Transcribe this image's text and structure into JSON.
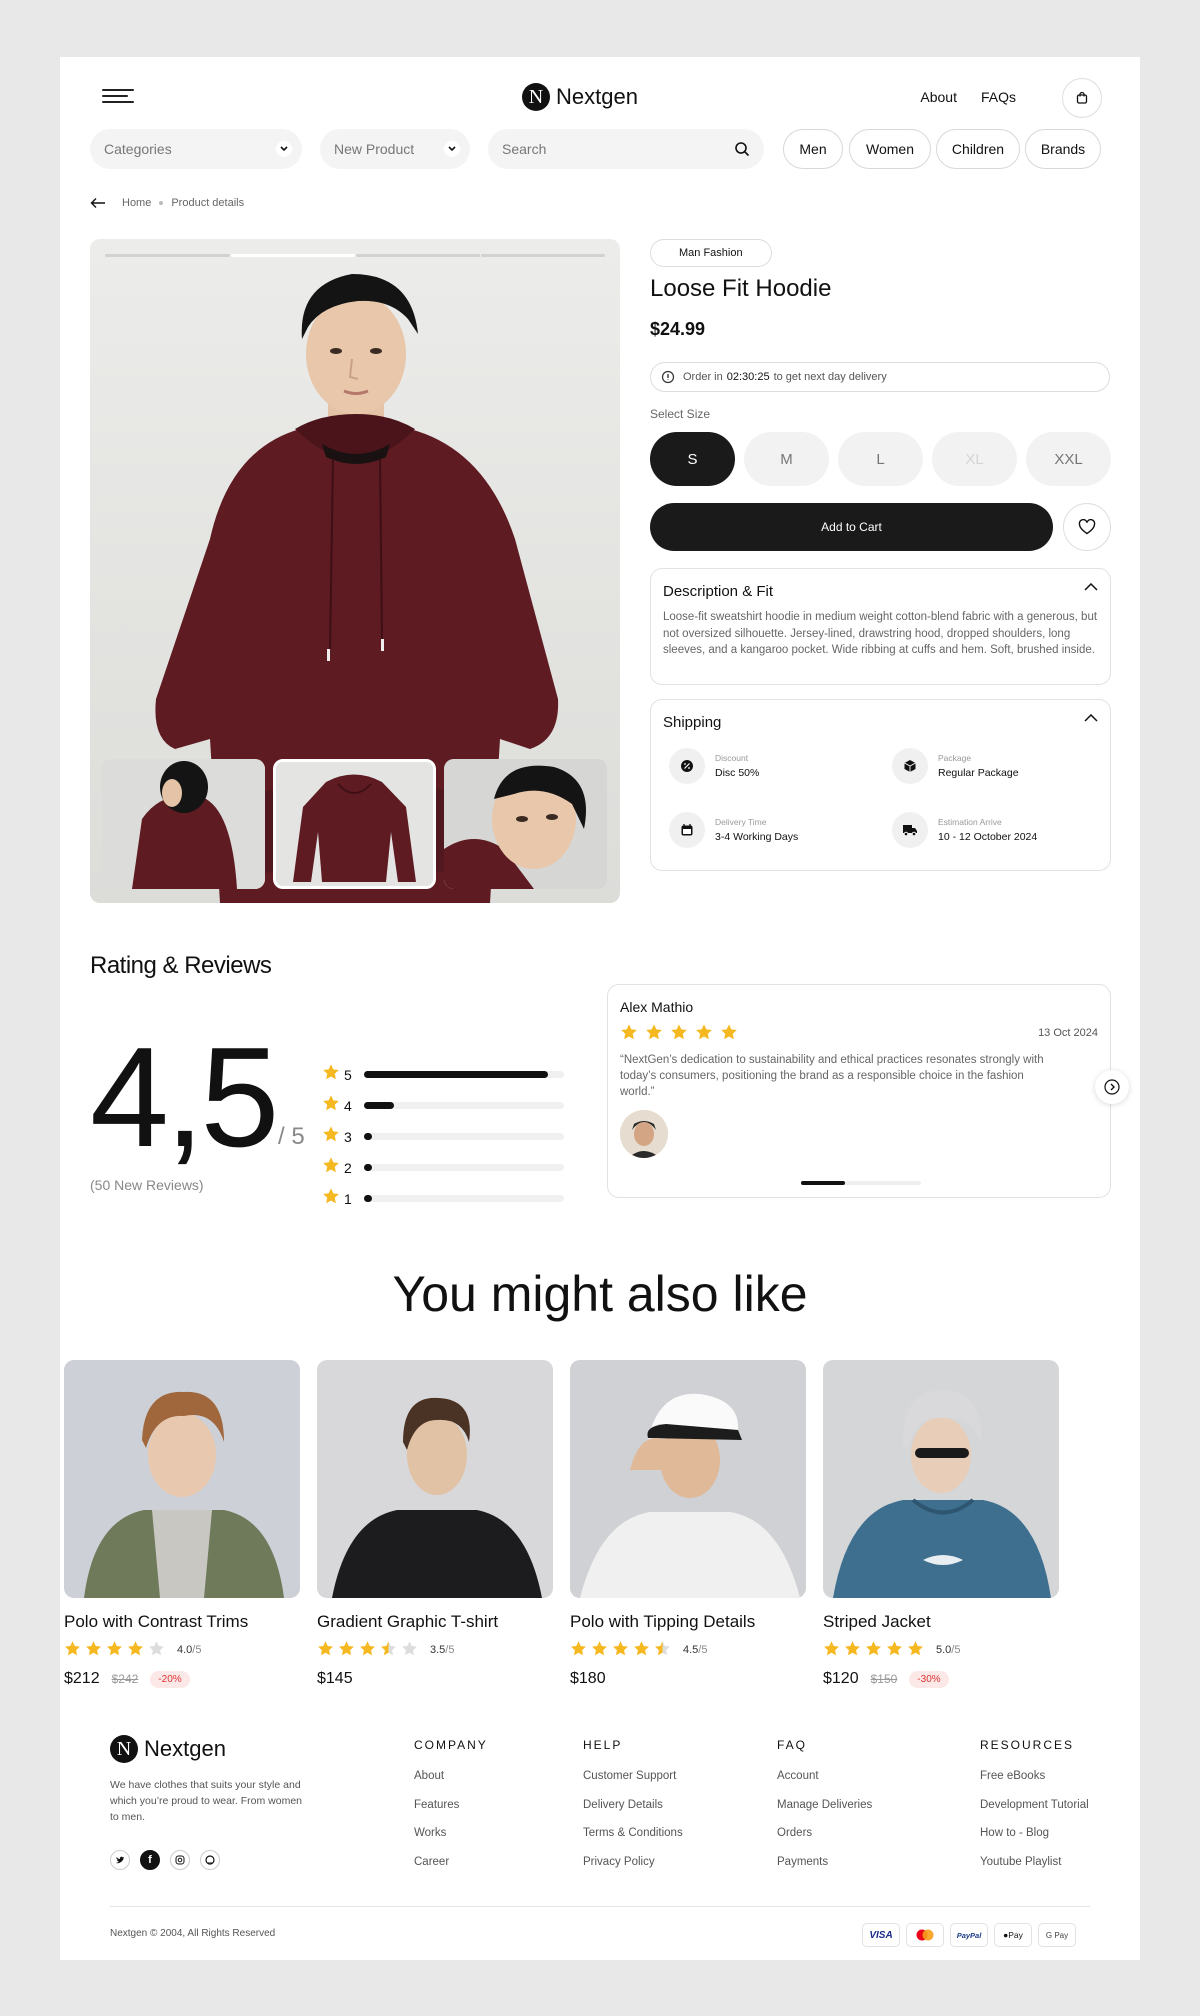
{
  "header": {
    "brand": "Nextgen",
    "logo_letter": "N",
    "nav": [
      "About",
      "FAQs"
    ]
  },
  "filters": {
    "categories": "Categories",
    "new_product": "New Product",
    "search_placeholder": "Search",
    "pills": [
      "Men",
      "Women",
      "Children",
      "Brands"
    ]
  },
  "breadcrumb": {
    "home": "Home",
    "current": "Product details"
  },
  "product": {
    "tag": "Man Fashion",
    "title": "Loose Fit Hoodie",
    "price": "$24.99",
    "delivery_prefix": "Order in",
    "delivery_time": "02:30:25",
    "delivery_suffix": "to get next day delivery",
    "size_label": "Select Size",
    "sizes": [
      "S",
      "M",
      "L",
      "XL",
      "XXL"
    ],
    "selected_size": "S",
    "unavailable_size": "XL",
    "add_to_cart": "Add to Cart",
    "description_title": "Description & Fit",
    "description": "Loose-fit sweatshirt hoodie in medium weight cotton-blend fabric with a generous, but not oversized silhouette. Jersey-lined, drawstring hood, dropped shoulders, long sleeves, and a kangaroo pocket. Wide ribbing at cuffs and hem. Soft, brushed inside.",
    "shipping_title": "Shipping",
    "shipping": [
      {
        "label": "Discount",
        "value": "Disc 50%",
        "icon": "discount-icon"
      },
      {
        "label": "Package",
        "value": "Regular Package",
        "icon": "package-icon"
      },
      {
        "label": "Delivery Time",
        "value": "3-4 Working Days",
        "icon": "calendar-icon"
      },
      {
        "label": "Estimation Arrive",
        "value": "10 - 12 October 2024",
        "icon": "truck-icon"
      }
    ]
  },
  "ratings": {
    "title": "Rating & Reviews",
    "score": "4,5",
    "max": "/ 5",
    "count": "(50 New Reviews)",
    "bars": [
      {
        "star": "5",
        "fraction": 0.92
      },
      {
        "star": "4",
        "fraction": 0.15
      },
      {
        "star": "3",
        "fraction": 0.04
      },
      {
        "star": "2",
        "fraction": 0.02
      },
      {
        "star": "1",
        "fraction": 0.02
      }
    ],
    "review": {
      "name": "Alex Mathio",
      "date": "13 Oct 2024",
      "stars": 5,
      "text": "“NextGen’s dedication to sustainability and ethical practices resonates strongly with today’s consumers, positioning the brand as a responsible choice in the fashion world.”"
    }
  },
  "also_like": {
    "title": "You might also like",
    "products": [
      {
        "name": "Polo with Contrast Trims",
        "rating": "4.0",
        "den": "/5",
        "stars": 4.0,
        "price": "$212",
        "old": "$242",
        "discount": "-20%"
      },
      {
        "name": "Gradient Graphic T-shirt",
        "rating": "3.5",
        "den": "/5",
        "stars": 3.5,
        "price": "$145",
        "old": "",
        "discount": ""
      },
      {
        "name": "Polo with Tipping Details",
        "rating": "4.5",
        "den": "/5",
        "stars": 4.5,
        "price": "$180",
        "old": "",
        "discount": ""
      },
      {
        "name": "Striped Jacket",
        "rating": "5.0",
        "den": "/5",
        "stars": 5.0,
        "price": "$120",
        "old": "$150",
        "discount": "-30%"
      }
    ]
  },
  "footer": {
    "about": "We have clothes that suits your style and which you’re proud to wear. From women to men.",
    "columns": [
      {
        "heading": "COMPANY",
        "links": [
          "About",
          "Features",
          "Works",
          "Career"
        ]
      },
      {
        "heading": "HELP",
        "links": [
          "Customer Support",
          "Delivery Details",
          "Terms & Conditions",
          "Privacy Policy"
        ]
      },
      {
        "heading": "FAQ",
        "links": [
          "Account",
          "Manage Deliveries",
          "Orders",
          "Payments"
        ]
      },
      {
        "heading": "RESOURCES",
        "links": [
          "Free eBooks",
          "Development Tutorial",
          "How to - Blog",
          "Youtube Playlist"
        ]
      }
    ],
    "copyright": "Nextgen © 2004, All Rights Reserved",
    "payments": [
      "VISA",
      "",
      "PayPal",
      "Pay",
      "G Pay"
    ]
  },
  "colors": {
    "accent": "#111111",
    "star": "#f5b820",
    "discount": "#dd3333",
    "hoodie": "#5e1b22"
  }
}
